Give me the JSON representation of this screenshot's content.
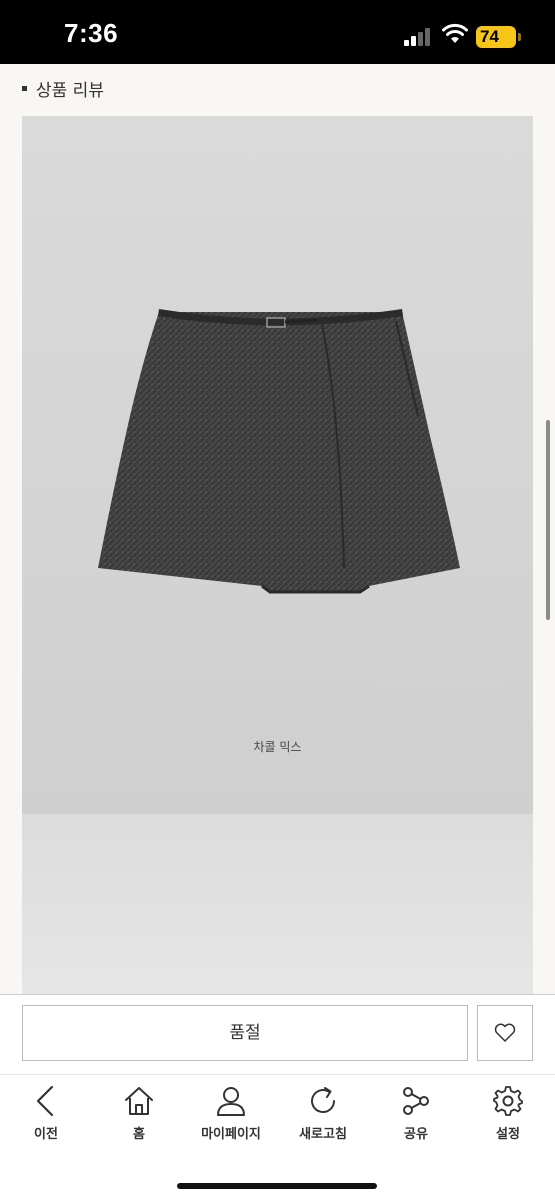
{
  "status_bar": {
    "time": "7:36",
    "battery": "74"
  },
  "section": {
    "heading": "상품 리뷰"
  },
  "product": {
    "caption": "차콜 믹스"
  },
  "actions": {
    "soldout_label": "품절"
  },
  "nav": {
    "items": [
      {
        "label": "이전",
        "icon": "back-chevron-icon"
      },
      {
        "label": "홈",
        "icon": "home-icon"
      },
      {
        "label": "마이페이지",
        "icon": "person-icon"
      },
      {
        "label": "새로고침",
        "icon": "refresh-icon"
      },
      {
        "label": "공유",
        "icon": "share-icon"
      },
      {
        "label": "설정",
        "icon": "gear-icon"
      }
    ]
  },
  "colors": {
    "battery": "#f5c518",
    "page_bg": "#f8f7f3",
    "skirt": "#3a3a3a"
  }
}
